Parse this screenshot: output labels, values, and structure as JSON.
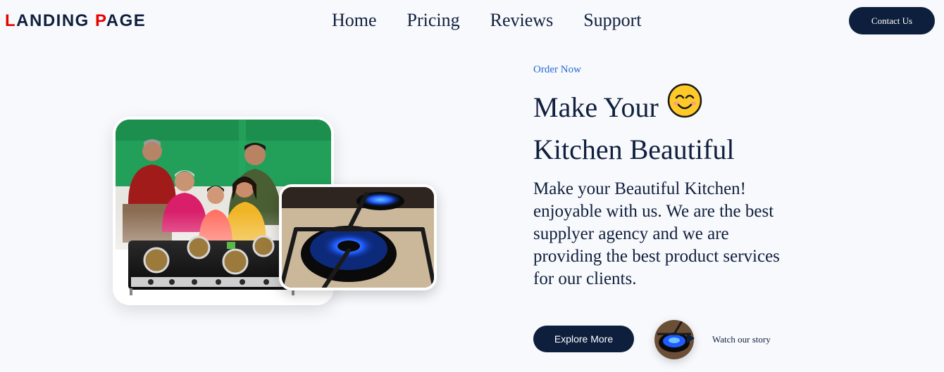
{
  "header": {
    "logo_first_initial": "L",
    "logo_first_rest": "ANDING ",
    "logo_second_initial": "P",
    "logo_second_rest": "AGE",
    "nav": [
      "Home",
      "Pricing",
      "Reviews",
      "Support"
    ],
    "contact_label": "Contact Us"
  },
  "hero": {
    "eyebrow": "Order Now",
    "headline_line1": "Make Your",
    "headline_line2": "Kitchen Beautiful",
    "emoji_icon": "smiling-face-icon",
    "description": "Make your Beautiful Kitchen! enjoyable with us. We are the best supplyer agency and we are providing the best product services for our clients.",
    "explore_label": "Explore More",
    "watch_label": "Watch our story"
  },
  "images": {
    "family_photo": "family-with-gas-stove",
    "flame_photo": "gas-burner-flame"
  },
  "colors": {
    "primary_navy": "#0d1f3c",
    "logo_accent": "#e60000",
    "eyebrow_blue": "#2469d6",
    "photo_green": "#22a05a"
  }
}
